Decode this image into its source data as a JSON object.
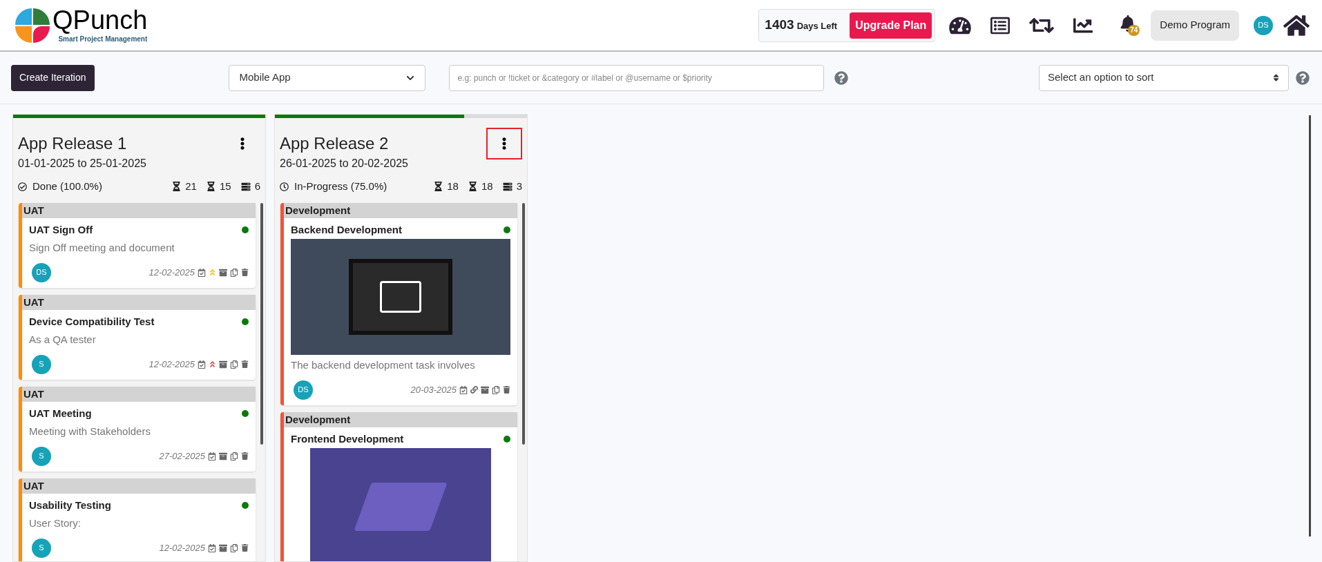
{
  "header": {
    "logo": {
      "name": "QPunch",
      "tagline": "Smart Project Management"
    },
    "plan": {
      "days": "1403",
      "days_label": "Days Left",
      "button": "Upgrade Plan"
    },
    "notifications": {
      "badge": "74"
    },
    "program": "Demo Program",
    "user": {
      "initials": "DS"
    }
  },
  "toolbar": {
    "create_button": "Create Iteration",
    "project_select": {
      "value": "Mobile App"
    },
    "search": {
      "placeholder": "e.g: punch or !ticket or &category or #label or @username or $priority"
    },
    "sort_select": {
      "value": "Select an option to sort"
    }
  },
  "iterations": [
    {
      "title": "App Release 1",
      "dates": "01-01-2025 to 25-01-2025",
      "status": {
        "kind": "done",
        "label": "Done (100.0%)"
      },
      "level": 1,
      "menu_highlighted": false,
      "stats": {
        "estimated": "21",
        "spent": "15",
        "tasks": "6"
      },
      "tasks": [
        {
          "category": "UAT",
          "title": "UAT Sign Off",
          "description": "Sign Off meeting and document",
          "color": "#ff8c00",
          "status": {
            "color": "#0b7a0b"
          },
          "assignee": "DS",
          "due": "12-02-2025",
          "priority": {
            "kind": "medium"
          },
          "linked": false
        },
        {
          "category": "UAT",
          "title": "Device Compatibility Test",
          "description": "As a QA tester",
          "color": "#ff8c00",
          "status": {
            "color": "#0b7a0b"
          },
          "assignee": "S",
          "due": "12-02-2025",
          "priority": {
            "kind": "high"
          },
          "linked": false
        },
        {
          "category": "UAT",
          "title": "UAT Meeting",
          "description": "Meeting with Stakeholders",
          "color": "#ff8c00",
          "status": {
            "color": "#0b7a0b"
          },
          "assignee": "S",
          "due": "27-02-2025",
          "linked": false
        },
        {
          "category": "UAT",
          "title": "Usability Testing",
          "description": "User Story:",
          "color": "#ff8c00",
          "status": {
            "color": "#0b7a0b"
          },
          "assignee": "S",
          "due": "12-02-2025",
          "linked": false
        }
      ]
    },
    {
      "title": "App Release 2",
      "dates": "26-01-2025 to 20-02-2025",
      "status": {
        "kind": "in_progress",
        "label": "In-Progress (75.0%)"
      },
      "level": 0.75,
      "menu_highlighted": true,
      "stats": {
        "estimated": "18",
        "spent": "18",
        "tasks": "3"
      },
      "tasks": [
        {
          "category": "Development",
          "title": "Backend Development",
          "image": {
            "kind": "monitor"
          },
          "description": "The backend development task involves",
          "color": "#f0533a",
          "status": {
            "color": "#0b7a0b"
          },
          "assignee": "DS",
          "due": "20-03-2025",
          "linked": true
        },
        {
          "category": "Development",
          "title": "Frontend Development",
          "image": {
            "kind": "laptop"
          },
          "color": "#f0533a",
          "status": {
            "color": "#0b7a0b"
          }
        }
      ]
    }
  ]
}
